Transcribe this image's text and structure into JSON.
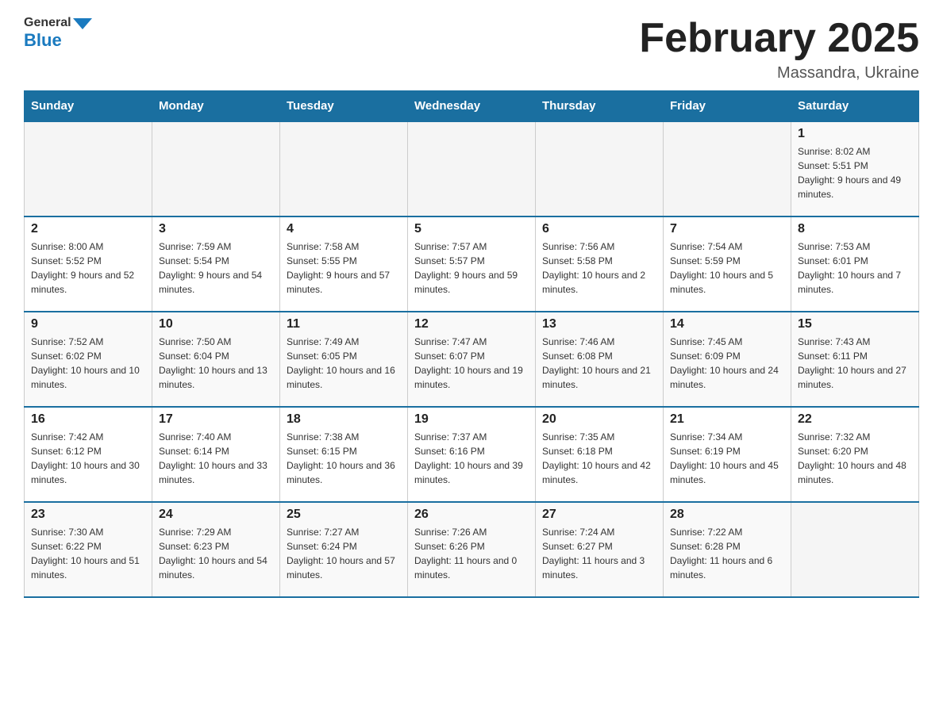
{
  "header": {
    "logo_general": "General",
    "logo_blue": "Blue",
    "month_title": "February 2025",
    "location": "Massandra, Ukraine"
  },
  "weekdays": [
    "Sunday",
    "Monday",
    "Tuesday",
    "Wednesday",
    "Thursday",
    "Friday",
    "Saturday"
  ],
  "weeks": [
    [
      {
        "day": "",
        "info": ""
      },
      {
        "day": "",
        "info": ""
      },
      {
        "day": "",
        "info": ""
      },
      {
        "day": "",
        "info": ""
      },
      {
        "day": "",
        "info": ""
      },
      {
        "day": "",
        "info": ""
      },
      {
        "day": "1",
        "info": "Sunrise: 8:02 AM\nSunset: 5:51 PM\nDaylight: 9 hours and 49 minutes."
      }
    ],
    [
      {
        "day": "2",
        "info": "Sunrise: 8:00 AM\nSunset: 5:52 PM\nDaylight: 9 hours and 52 minutes."
      },
      {
        "day": "3",
        "info": "Sunrise: 7:59 AM\nSunset: 5:54 PM\nDaylight: 9 hours and 54 minutes."
      },
      {
        "day": "4",
        "info": "Sunrise: 7:58 AM\nSunset: 5:55 PM\nDaylight: 9 hours and 57 minutes."
      },
      {
        "day": "5",
        "info": "Sunrise: 7:57 AM\nSunset: 5:57 PM\nDaylight: 9 hours and 59 minutes."
      },
      {
        "day": "6",
        "info": "Sunrise: 7:56 AM\nSunset: 5:58 PM\nDaylight: 10 hours and 2 minutes."
      },
      {
        "day": "7",
        "info": "Sunrise: 7:54 AM\nSunset: 5:59 PM\nDaylight: 10 hours and 5 minutes."
      },
      {
        "day": "8",
        "info": "Sunrise: 7:53 AM\nSunset: 6:01 PM\nDaylight: 10 hours and 7 minutes."
      }
    ],
    [
      {
        "day": "9",
        "info": "Sunrise: 7:52 AM\nSunset: 6:02 PM\nDaylight: 10 hours and 10 minutes."
      },
      {
        "day": "10",
        "info": "Sunrise: 7:50 AM\nSunset: 6:04 PM\nDaylight: 10 hours and 13 minutes."
      },
      {
        "day": "11",
        "info": "Sunrise: 7:49 AM\nSunset: 6:05 PM\nDaylight: 10 hours and 16 minutes."
      },
      {
        "day": "12",
        "info": "Sunrise: 7:47 AM\nSunset: 6:07 PM\nDaylight: 10 hours and 19 minutes."
      },
      {
        "day": "13",
        "info": "Sunrise: 7:46 AM\nSunset: 6:08 PM\nDaylight: 10 hours and 21 minutes."
      },
      {
        "day": "14",
        "info": "Sunrise: 7:45 AM\nSunset: 6:09 PM\nDaylight: 10 hours and 24 minutes."
      },
      {
        "day": "15",
        "info": "Sunrise: 7:43 AM\nSunset: 6:11 PM\nDaylight: 10 hours and 27 minutes."
      }
    ],
    [
      {
        "day": "16",
        "info": "Sunrise: 7:42 AM\nSunset: 6:12 PM\nDaylight: 10 hours and 30 minutes."
      },
      {
        "day": "17",
        "info": "Sunrise: 7:40 AM\nSunset: 6:14 PM\nDaylight: 10 hours and 33 minutes."
      },
      {
        "day": "18",
        "info": "Sunrise: 7:38 AM\nSunset: 6:15 PM\nDaylight: 10 hours and 36 minutes."
      },
      {
        "day": "19",
        "info": "Sunrise: 7:37 AM\nSunset: 6:16 PM\nDaylight: 10 hours and 39 minutes."
      },
      {
        "day": "20",
        "info": "Sunrise: 7:35 AM\nSunset: 6:18 PM\nDaylight: 10 hours and 42 minutes."
      },
      {
        "day": "21",
        "info": "Sunrise: 7:34 AM\nSunset: 6:19 PM\nDaylight: 10 hours and 45 minutes."
      },
      {
        "day": "22",
        "info": "Sunrise: 7:32 AM\nSunset: 6:20 PM\nDaylight: 10 hours and 48 minutes."
      }
    ],
    [
      {
        "day": "23",
        "info": "Sunrise: 7:30 AM\nSunset: 6:22 PM\nDaylight: 10 hours and 51 minutes."
      },
      {
        "day": "24",
        "info": "Sunrise: 7:29 AM\nSunset: 6:23 PM\nDaylight: 10 hours and 54 minutes."
      },
      {
        "day": "25",
        "info": "Sunrise: 7:27 AM\nSunset: 6:24 PM\nDaylight: 10 hours and 57 minutes."
      },
      {
        "day": "26",
        "info": "Sunrise: 7:26 AM\nSunset: 6:26 PM\nDaylight: 11 hours and 0 minutes."
      },
      {
        "day": "27",
        "info": "Sunrise: 7:24 AM\nSunset: 6:27 PM\nDaylight: 11 hours and 3 minutes."
      },
      {
        "day": "28",
        "info": "Sunrise: 7:22 AM\nSunset: 6:28 PM\nDaylight: 11 hours and 6 minutes."
      },
      {
        "day": "",
        "info": ""
      }
    ]
  ]
}
